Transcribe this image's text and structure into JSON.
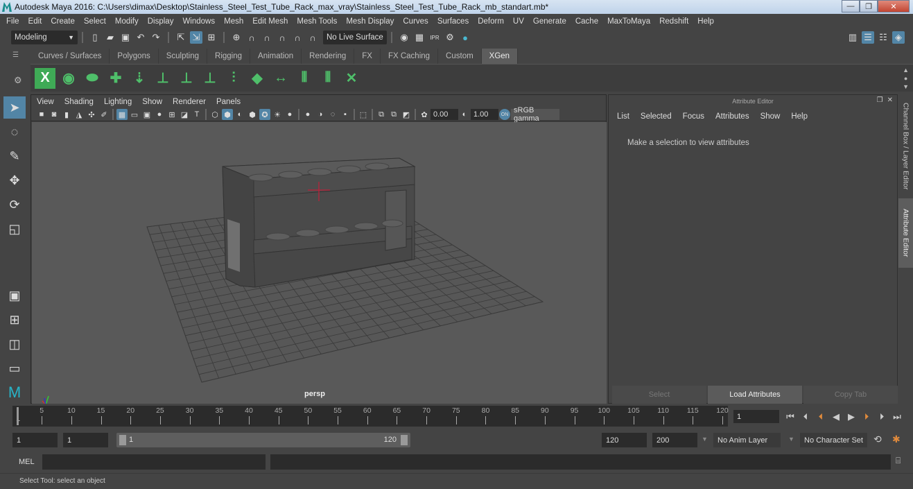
{
  "window": {
    "title": "Autodesk Maya 2016: C:\\Users\\dimax\\Desktop\\Stainless_Steel_Test_Tube_Rack_max_vray\\Stainless_Steel_Test_Tube_Rack_mb_standart.mb*",
    "minimize": "—",
    "maximize": "❐",
    "close": "✕"
  },
  "menubar": [
    "File",
    "Edit",
    "Create",
    "Select",
    "Modify",
    "Display",
    "Windows",
    "Mesh",
    "Edit Mesh",
    "Mesh Tools",
    "Mesh Display",
    "Curves",
    "Surfaces",
    "Deform",
    "UV",
    "Generate",
    "Cache",
    "MaxToMaya",
    "Redshift",
    "Help"
  ],
  "statusline": {
    "mode": "Modeling",
    "live_surface": "No Live Surface"
  },
  "shelf_tabs": [
    "Curves / Surfaces",
    "Polygons",
    "Sculpting",
    "Rigging",
    "Animation",
    "Rendering",
    "FX",
    "FX Caching",
    "Custom",
    "XGen"
  ],
  "shelf_active": "XGen",
  "viewport": {
    "menu": [
      "View",
      "Shading",
      "Lighting",
      "Show",
      "Renderer",
      "Panels"
    ],
    "exposure": "0.00",
    "gamma": "1.00",
    "color_mgmt_toggle": "ON",
    "color_space": "sRGB gamma",
    "camera_label": "persp"
  },
  "attribute_editor": {
    "title": "Attribute Editor",
    "menu": [
      "List",
      "Selected",
      "Focus",
      "Attributes",
      "Show",
      "Help"
    ],
    "message": "Make a selection to view attributes",
    "buttons": {
      "select": "Select",
      "load": "Load Attributes",
      "copy": "Copy Tab"
    }
  },
  "side_tabs": {
    "channel_box": "Channel Box / Layer Editor",
    "attribute_editor": "Attribute Editor"
  },
  "timeline": {
    "start_label": "1",
    "ticks": [
      "5",
      "10",
      "15",
      "20",
      "25",
      "30",
      "35",
      "40",
      "45",
      "50",
      "55",
      "60",
      "65",
      "70",
      "75",
      "80",
      "85",
      "90",
      "95",
      "100",
      "105",
      "110",
      "115",
      "120"
    ],
    "current_frame": "1"
  },
  "range": {
    "start": "1",
    "anim_start": "1",
    "slider_min": "1",
    "slider_max": "120",
    "end": "120",
    "anim_end": "200",
    "anim_layer": "No Anim Layer",
    "character_set": "No Character Set"
  },
  "command_line": {
    "label": "MEL"
  },
  "status": {
    "help_text": "Select Tool: select an object"
  }
}
